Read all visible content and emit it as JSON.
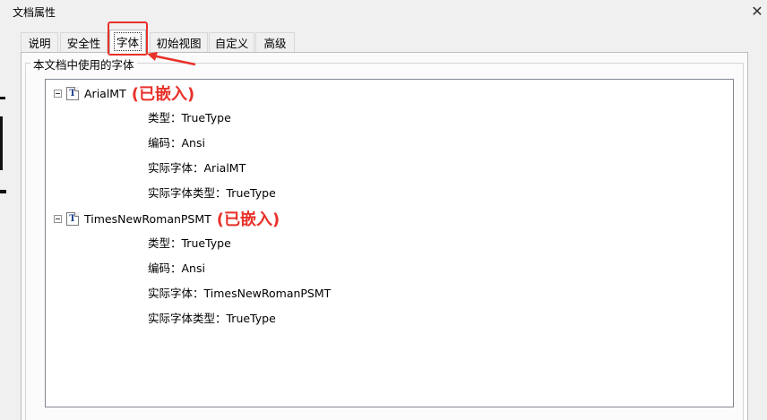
{
  "window": {
    "title": "文档属性",
    "close_glyph": "✕"
  },
  "tabs": [
    {
      "label": "说明"
    },
    {
      "label": "安全性"
    },
    {
      "label": "字体"
    },
    {
      "label": "初始视图"
    },
    {
      "label": "自定义"
    },
    {
      "label": "高级"
    }
  ],
  "active_tab": "字体",
  "fonts_group": {
    "legend": "本文档中使用的字体",
    "fonts": [
      {
        "name": "ArialMT",
        "annotation": "(已嵌入)",
        "type": "类型：TrueType",
        "encoding": "编码：Ansi",
        "actual_font": "实际字体：ArialMT",
        "actual_type": "实际字体类型：TrueType"
      },
      {
        "name": "TimesNewRomanPSMT",
        "annotation": "(已嵌入)",
        "type": "类型：TrueType",
        "encoding": "编码：Ansi",
        "actual_font": "实际字体：TimesNewRomanPSMT",
        "actual_type": "实际字体类型：TrueType"
      }
    ]
  },
  "icons": {
    "font": "truetype-font-icon",
    "collapse": "minus-square-icon",
    "close": "close-icon"
  },
  "colors": {
    "annotation_red": "#e8312a",
    "window_bg": "#f0f0f0"
  }
}
